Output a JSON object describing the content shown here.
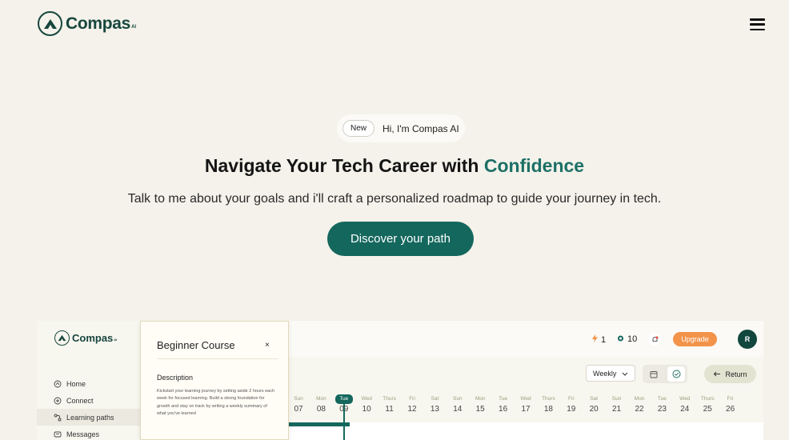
{
  "brand": {
    "name": "Compas",
    "suffix": "AI",
    "color": "#17463e",
    "accent": "#14675d"
  },
  "nav": {
    "menu_icon": "hamburger-icon"
  },
  "hero": {
    "badge": "New",
    "badge_text": "Hi, I'm Compas AI",
    "headline_prefix": "Navigate Your Tech Career with ",
    "headline_accent": "Confidence",
    "subline": "Talk to me about your goals and i'll craft a personalized roadmap to guide your journey in tech.",
    "cta": "Discover your path"
  },
  "preview": {
    "logo": "Compas",
    "logo_suffix": "AI",
    "nav_items": [
      {
        "label": "Home",
        "icon": "home-icon"
      },
      {
        "label": "Connect",
        "icon": "plus-circle-icon"
      },
      {
        "label": "Learning paths",
        "icon": "paths-icon",
        "active": true
      },
      {
        "label": "Messages",
        "icon": "message-icon"
      }
    ],
    "streak": "1",
    "coins": "10",
    "upgrade": "Upgrade",
    "avatar": "R",
    "view_select": "Weekly",
    "return": "Return",
    "modal": {
      "title": "Beginner Course",
      "close": "×",
      "section": "Description",
      "description": "Kickstart your learning journey by setting aside 2 hours each week for focused learning. Build a strong foundation for growth and stay on track by writing a weekly summary of what you've learned"
    },
    "days": [
      {
        "name": "Sun",
        "num": "07"
      },
      {
        "name": "Mon",
        "num": "08"
      },
      {
        "name": "Tue",
        "num": "09",
        "today": true
      },
      {
        "name": "Wed",
        "num": "10"
      },
      {
        "name": "Thurs",
        "num": "11"
      },
      {
        "name": "Fri",
        "num": "12"
      },
      {
        "name": "Sat",
        "num": "13"
      },
      {
        "name": "Sun",
        "num": "14"
      },
      {
        "name": "Mon",
        "num": "15"
      },
      {
        "name": "Tue",
        "num": "16"
      },
      {
        "name": "Wed",
        "num": "17"
      },
      {
        "name": "Thurs",
        "num": "18"
      },
      {
        "name": "Fri",
        "num": "19"
      },
      {
        "name": "Sat",
        "num": "20"
      },
      {
        "name": "Sun",
        "num": "21"
      },
      {
        "name": "Mon",
        "num": "22"
      },
      {
        "name": "Tue",
        "num": "23"
      },
      {
        "name": "Wed",
        "num": "24"
      },
      {
        "name": "Thurs",
        "num": "25"
      },
      {
        "name": "Fri",
        "num": "26"
      }
    ]
  }
}
